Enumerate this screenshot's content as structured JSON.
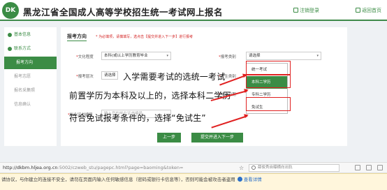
{
  "header": {
    "logo_text": "DK",
    "title": "黑龙江省全国成人高等学校招生统一考试网上报名",
    "links": [
      "注销登录",
      "返回首页"
    ]
  },
  "sidebar": {
    "items": [
      {
        "label": "基本信息",
        "state": "done"
      },
      {
        "label": "联系方式",
        "state": "done"
      },
      {
        "label": "报考方向",
        "state": "active"
      },
      {
        "label": "报考志愿",
        "state": "pending"
      },
      {
        "label": "报名采集照",
        "state": "pending"
      },
      {
        "label": "信息确认",
        "state": "pending"
      }
    ]
  },
  "form": {
    "section_title": "报考方向",
    "note": "* 为必填项，请慎填写，选点击【提交并进入下一步】进行报考",
    "wenhua_label": "文化程度",
    "wenhua_value": "本科(或以上学历教育毕业",
    "leibie_label": "报考类别",
    "leibie_value": "请选择",
    "kemu_label": "报考层次",
    "kemu_value": "请选择",
    "kaosheng_label": "考生类别",
    "bylb_label": "毕业日期",
    "cert_label": "毕业证书编号",
    "cert_placeholder": "输入您的毕业证书编号"
  },
  "dropdown": {
    "options": [
      "统一考试",
      "本科二学历",
      "专科二学历",
      "免试生"
    ],
    "selected": "本科二学历"
  },
  "annotations": {
    "line1": "入学需要考试的选统一考试",
    "line2": "前置学历为本科及以上的，选择本科二学历",
    "line3": "符合免试报考条件的，选择“免试生”"
  },
  "buttons": {
    "prev": "上一步",
    "next": "提交并进入下一步"
  },
  "browser": {
    "url_main": "http://dkbm.hljea.org.cn",
    "url_rest": ":5002/czweb_stu/pagepc.html?page=baoming&token=",
    "search_placeholder": "薛俊秀自曝横向出轨"
  },
  "warning": {
    "text": "请协议，与你建立的连接不安全，请勿在页面内输入任何敏感信息（密码或银行卡信息等），否则可能会被攻击者盗用",
    "detail": "查看详情"
  }
}
